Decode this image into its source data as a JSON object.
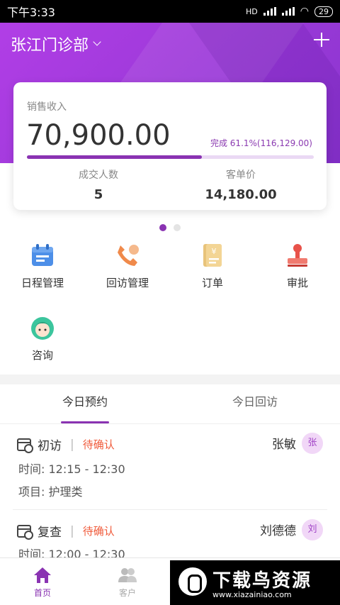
{
  "status_bar": {
    "time": "下午3:33",
    "network": "HD",
    "battery": "29"
  },
  "header": {
    "clinic": "张江门诊部"
  },
  "sales": {
    "label": "销售收入",
    "amount": "70,900.00",
    "completion": "完成 61.1%(116,129.00)",
    "progress_fraction": 0.611,
    "stats": [
      {
        "label": "成交人数",
        "value": "5"
      },
      {
        "label": "客单价",
        "value": "14,180.00"
      }
    ]
  },
  "pager": {
    "pages": 2,
    "active_index": 0
  },
  "actions": [
    {
      "label": "日程管理",
      "icon": "calendar-icon"
    },
    {
      "label": "回访管理",
      "icon": "phone-callback-icon"
    },
    {
      "label": "订单",
      "icon": "order-icon"
    },
    {
      "label": "审批",
      "icon": "stamp-icon"
    },
    {
      "label": "咨询",
      "icon": "consultant-icon"
    }
  ],
  "tabs": [
    {
      "label": "今日预约",
      "active": true
    },
    {
      "label": "今日回访",
      "active": false
    }
  ],
  "appointments": [
    {
      "type": "初访",
      "status": "待确认",
      "customer": "张敏",
      "avatar": "张",
      "time": "时间: 12:15 - 12:30",
      "item": "项目: 护理类"
    },
    {
      "type": "复查",
      "status": "待确认",
      "customer": "刘德德",
      "avatar": "刘",
      "time": "时间: 12:00 - 12:30"
    }
  ],
  "bottom_nav": [
    {
      "label": "首页",
      "icon": "home-icon",
      "active": true
    },
    {
      "label": "客户",
      "icon": "customers-icon",
      "active": false
    }
  ],
  "watermark": {
    "title": "下载鸟资源",
    "url": "www.xiazainiao.com"
  },
  "colors": {
    "brand_purple": "#8a33b2",
    "pending": "#f05b3b",
    "header_gradient_start": "#b13ee6"
  }
}
